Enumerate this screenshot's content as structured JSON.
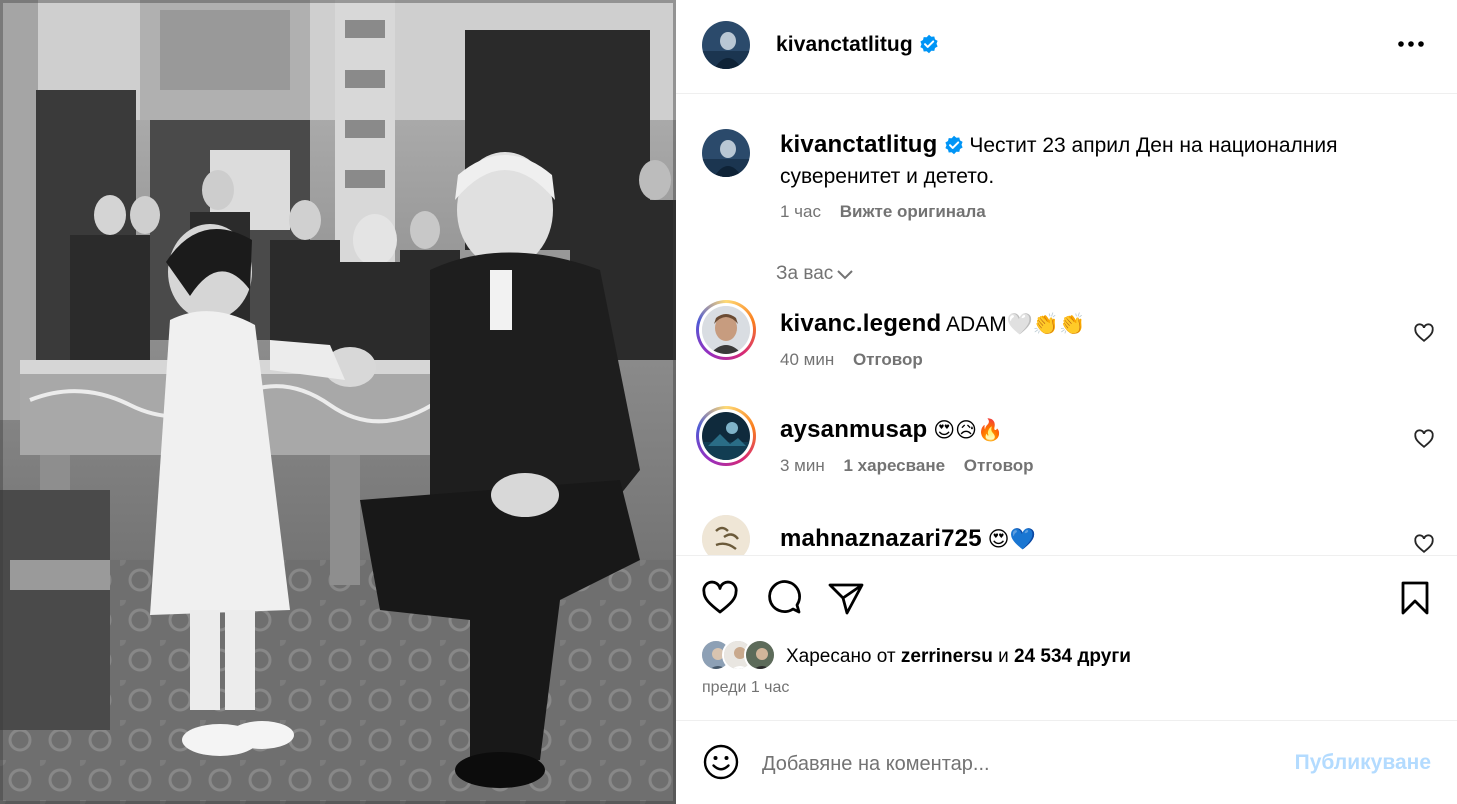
{
  "post": {
    "username": "kivanctatlitug",
    "verified": true,
    "caption": "Честит 23 април Ден на националния суверенитет и детето.",
    "time": "1 час",
    "see_original": "Вижте оригинала"
  },
  "for_you": "За вас",
  "comments": [
    {
      "username": "kivanc.legend",
      "text": "ADAM🤍👏👏",
      "time": "40 мин",
      "likes": "",
      "reply": "Отговор"
    },
    {
      "username": "aysanmusap",
      "text": "😍😥🔥",
      "time": "3 мин",
      "likes": "1 харесване",
      "reply": "Отговор"
    },
    {
      "username": "mahnaznazari725",
      "text": "😍💙",
      "time": "",
      "likes": "",
      "reply": ""
    }
  ],
  "likes": {
    "prefix": "Харесано от",
    "user": "zerrinersu",
    "joiner": "и",
    "others": "24 534 други"
  },
  "time_ago": "преди 1 час",
  "add_comment": {
    "placeholder": "Добавяне на коментар...",
    "post_label": "Публикуване"
  },
  "icons": {
    "more": "more-horizontal-icon",
    "like": "heart-icon",
    "comment": "comment-bubble-icon",
    "share": "paper-plane-icon",
    "save": "bookmark-icon",
    "emoji": "smiley-icon",
    "verified": "verified-badge-icon",
    "expand": "chevron-down-icon"
  },
  "colors": {
    "verified_blue": "#0095f6",
    "secondary_text": "#737373",
    "post_disabled": "#b3dbff",
    "divider": "#efefef"
  }
}
